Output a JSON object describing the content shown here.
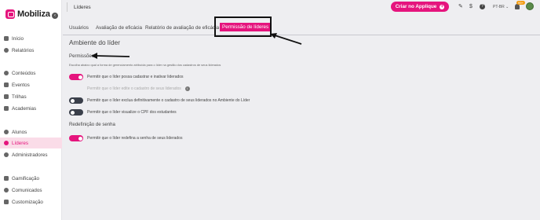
{
  "brand": {
    "name": "Mobiliza",
    "color": "#e5147d"
  },
  "sidebar": {
    "items": [
      {
        "label": "Início",
        "icon": "home-icon"
      },
      {
        "label": "Relatórios",
        "icon": "chart-pie-icon"
      },
      {
        "label": "Conteúdos",
        "icon": "content-icon"
      },
      {
        "label": "Eventos",
        "icon": "calendar-icon"
      },
      {
        "label": "Trilhas",
        "icon": "trail-icon"
      },
      {
        "label": "Academias",
        "icon": "academy-icon"
      },
      {
        "label": "Alunos",
        "icon": "user-icon"
      },
      {
        "label": "Líderes",
        "icon": "users-icon",
        "active": true
      },
      {
        "label": "Administradores",
        "icon": "admin-icon"
      },
      {
        "label": "Gamificação",
        "icon": "gamepad-icon"
      },
      {
        "label": "Comunicados",
        "icon": "chat-icon"
      },
      {
        "label": "Customização",
        "icon": "brush-icon"
      }
    ]
  },
  "header": {
    "breadcrumb": "Líderes",
    "cta_label": "Criar no Applique",
    "language": "PT-BR",
    "notification_badge": "99+"
  },
  "tabs": [
    {
      "label": "Usuários"
    },
    {
      "label": "Avaliação de eficácia"
    },
    {
      "label": "Relatório de avaliação de eficácia"
    },
    {
      "label": "Permissão de líderes",
      "active": true
    }
  ],
  "main": {
    "title": "Ambiente do líder",
    "permissions_title": "Permissões",
    "permissions_desc": "Escolha abaixo qual a forma de gerenciamento atribuída para o líder na gestão dos cadastros de seus liderados",
    "permissions": [
      {
        "label": "Permitir que o líder possa cadastrar e inativar liderados",
        "state": "on"
      },
      {
        "label": "Permitir que o líder edite o cadastro de seus liderados",
        "state": "disabled"
      },
      {
        "label": "Permitir que o líder exclua definitivamente o cadastro de seus liderados no Ambiente do Líder",
        "state": "off"
      },
      {
        "label": "Permitir que o líder visualize o CPF dos estudantes",
        "state": "off"
      }
    ],
    "reset_title": "Redefinição de senha",
    "reset_permissions": [
      {
        "label": "Permitir que o líder redefina a senha de seus liderados",
        "state": "on"
      }
    ]
  }
}
